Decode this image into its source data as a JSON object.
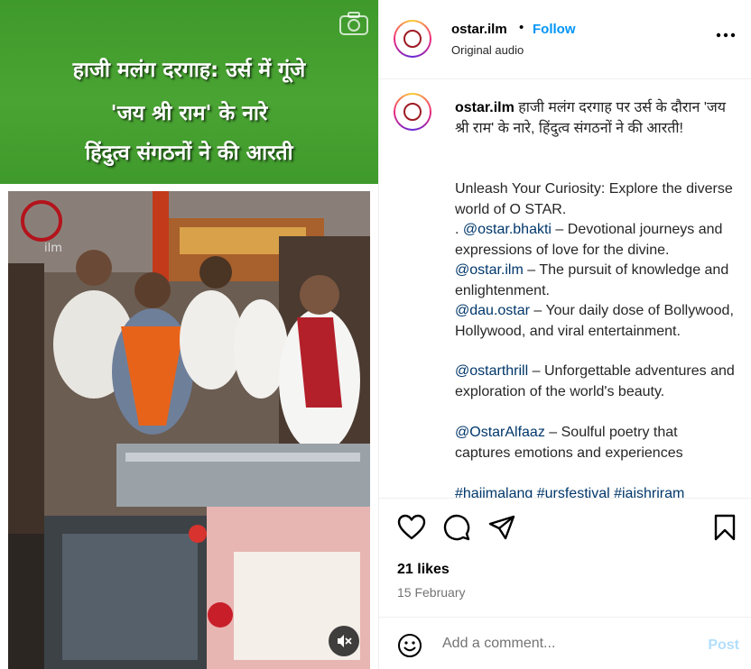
{
  "video": {
    "banner_lines": [
      "हाजी मलंग दरगाह: उर्स में गूंजे",
      "'जय श्री राम' के नारे",
      "हिंदुत्व संगठनों ने की आरती"
    ],
    "watermark_text": "ilm",
    "banner_color": "#4aa433"
  },
  "header": {
    "username": "ostar.ilm",
    "separator": "•",
    "follow_label": "Follow",
    "audio_label": "Original audio"
  },
  "caption": {
    "username": "ostar.ilm",
    "headline": "हाजी मलंग दरगाह पर उर्स के दौरान 'जय श्री राम' के नारे, हिंदुत्व संगठनों ने की आरती!",
    "intro": "Unleash Your Curiosity: Explore the diverse world of O STAR.",
    "prefix": ". ",
    "entries": [
      {
        "handle": "@ostar.bhakti",
        "text": " – Devotional journeys and expressions of love for the divine."
      },
      {
        "handle": "@ostar.ilm",
        "text": " – The pursuit of knowledge and enlightenment."
      },
      {
        "handle": "@dau.ostar",
        "text": " – Your daily dose of Bollywood, Hollywood, and viral entertainment."
      },
      {
        "handle": "@ostarthrill",
        "text": " – Unforgettable adventures and exploration of the world's beauty."
      },
      {
        "handle": "@OstarAlfaaz",
        "text": " – Soulful poetry that captures emotions and experiences"
      }
    ],
    "hashtags": "#hajimalang #ursfestival #jaishriram"
  },
  "actions": {
    "likes": "21 likes",
    "date": "15 February"
  },
  "comment": {
    "placeholder": "Add a comment...",
    "post_label": "Post"
  },
  "colors": {
    "link": "#0095f6",
    "mention": "#00376b",
    "post_disabled": "#b2dffc"
  }
}
